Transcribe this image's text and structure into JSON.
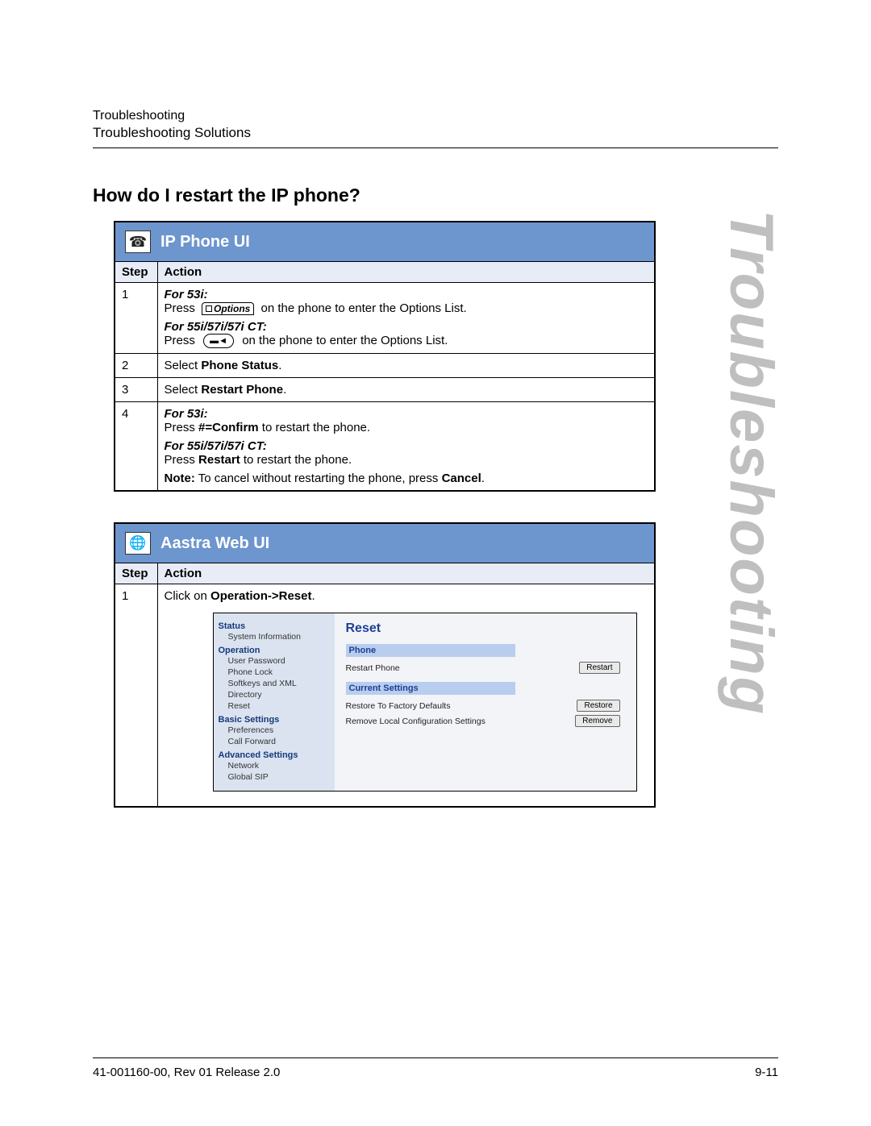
{
  "header": {
    "crumb1": "Troubleshooting",
    "crumb2": "Troubleshooting Solutions"
  },
  "watermark": "Troubleshooting",
  "heading": "How do I restart the IP phone?",
  "proc1": {
    "title": "IP Phone UI",
    "col_step": "Step",
    "col_action": "Action",
    "rows": {
      "r1": {
        "num": "1",
        "for53": "For 53i:",
        "press": "Press",
        "options_label": "Options",
        "after_btn": " on the phone to enter the Options List.",
        "for55": "For 55i/57i/57i CT:",
        "press2": "Press ",
        "after_btn2": " on the phone to enter the Options List."
      },
      "r2": {
        "num": "2",
        "pre": "Select ",
        "bold": "Phone Status",
        "post": "."
      },
      "r3": {
        "num": "3",
        "pre": "Select ",
        "bold": "Restart Phone",
        "post": "."
      },
      "r4": {
        "num": "4",
        "for53": "For 53i:",
        "l1a": "Press ",
        "l1b": "#=Confirm",
        "l1c": " to restart the phone.",
        "for55": "For 55i/57i/57i CT:",
        "l2a": "Press ",
        "l2b": "Restart",
        "l2c": " to restart the phone.",
        "note_a": "Note:",
        "note_b": " To cancel without restarting the phone, press ",
        "note_c": "Cancel",
        "note_d": "."
      }
    }
  },
  "proc2": {
    "title": "Aastra Web UI",
    "col_step": "Step",
    "col_action": "Action",
    "row1": {
      "num": "1",
      "pre": "Click on ",
      "bold": "Operation->Reset",
      "post": "."
    }
  },
  "webui": {
    "nav": {
      "status": "Status",
      "status_items": {
        "sysinfo": "System Information"
      },
      "operation": "Operation",
      "operation_items": {
        "userpw": "User Password",
        "phonelock": "Phone Lock",
        "softkeys": "Softkeys and XML",
        "directory": "Directory",
        "reset": "Reset"
      },
      "basic": "Basic Settings",
      "basic_items": {
        "prefs": "Preferences",
        "callfwd": "Call Forward"
      },
      "advanced": "Advanced Settings",
      "advanced_items": {
        "network": "Network",
        "globalsip": "Global SIP"
      }
    },
    "main": {
      "title": "Reset",
      "sec_phone": "Phone",
      "restart_phone": "Restart Phone",
      "btn_restart": "Restart",
      "sec_current": "Current Settings",
      "restore_defaults": "Restore To Factory Defaults",
      "btn_restore": "Restore",
      "remove_local": "Remove Local Configuration Settings",
      "btn_remove": "Remove"
    }
  },
  "footer": {
    "left": "41-001160-00, Rev 01  Release 2.0",
    "right": "9-11"
  }
}
